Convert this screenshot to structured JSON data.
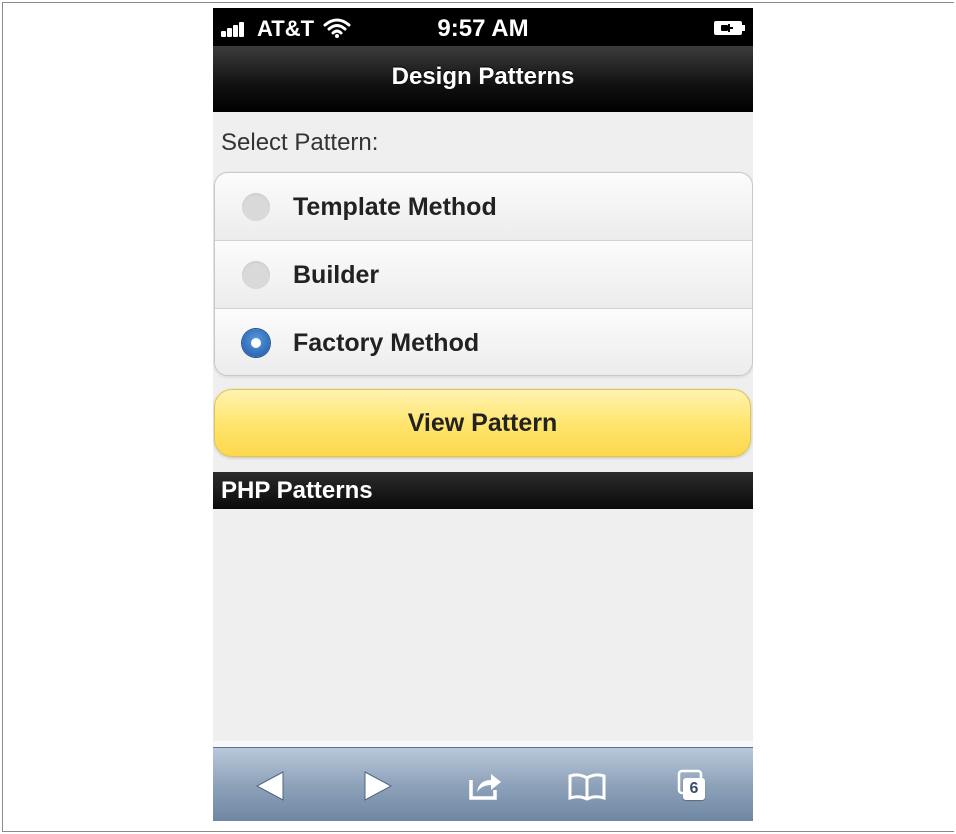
{
  "status_bar": {
    "carrier": "AT&T",
    "time": "9:57 AM"
  },
  "header": {
    "title": "Design Patterns"
  },
  "form": {
    "label": "Select Pattern:",
    "options": [
      {
        "label": "Template Method",
        "checked": false
      },
      {
        "label": "Builder",
        "checked": false
      },
      {
        "label": "Factory Method",
        "checked": true
      }
    ],
    "submit_label": "View Pattern"
  },
  "section": {
    "title": "PHP Patterns"
  },
  "toolbar": {
    "tab_count": "6",
    "icons": [
      "back-arrow-icon",
      "forward-arrow-icon",
      "share-icon",
      "bookmarks-icon",
      "tabs-icon"
    ]
  },
  "colors": {
    "button_yellow": "#ffe46a",
    "radio_checked": "#2e6ab6",
    "toolbar_blue": "#8ea2ba"
  }
}
